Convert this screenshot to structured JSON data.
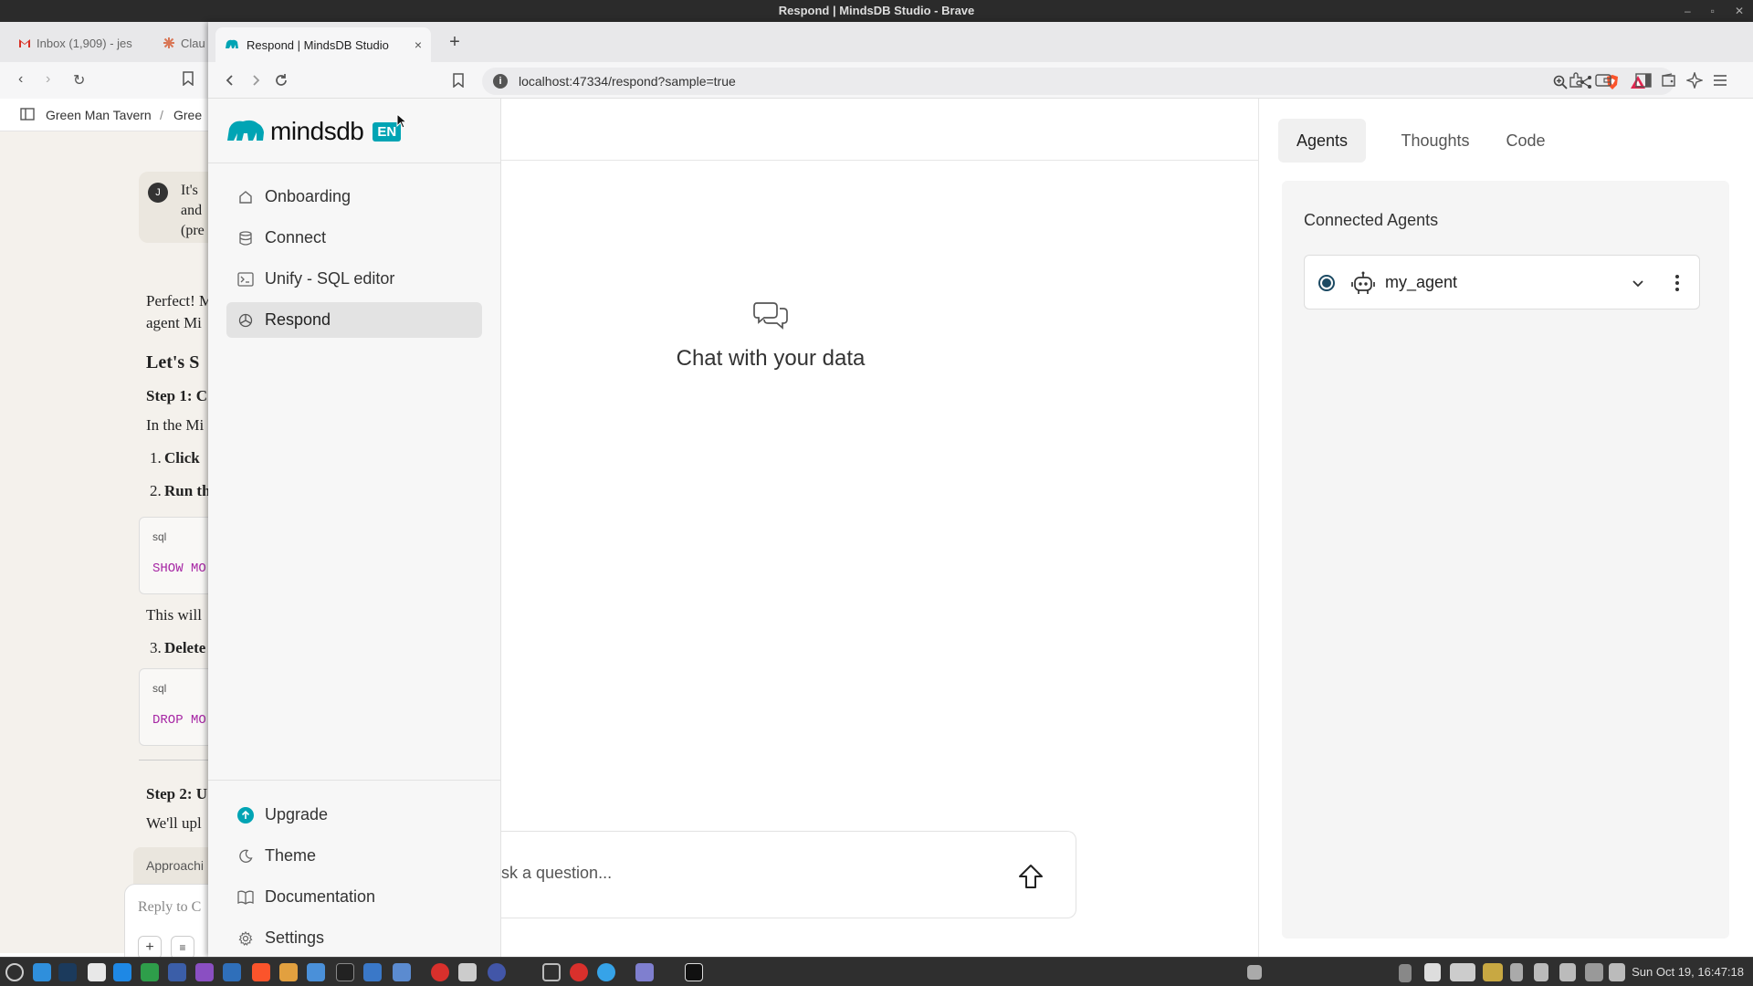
{
  "window_title": "Respond | MindsDB Studio - Brave",
  "background_window": {
    "tabs": [
      "Inbox (1,909) - jes",
      "Clau"
    ],
    "breadcrumb": [
      "Green Man Tavern",
      "/",
      "Gree"
    ],
    "chat_fragments": {
      "avatar_initial": "J",
      "msg_lines": [
        "It's",
        "and",
        "(pre"
      ],
      "p1": "Perfect! M",
      "p2": "agent Mi",
      "h1": "Let's S",
      "step1": "Step 1: C",
      "in_the": "In the Mi",
      "li1_num": "1.",
      "li1": "Click",
      "li2_num": "2.",
      "li2": "Run th",
      "code1_lang": "sql",
      "code1": "SHOW MO",
      "this_will": "This will",
      "li3_num": "3.",
      "li3": "Delete",
      "code2_lang": "sql",
      "code2": "DROP MO",
      "step2": "Step 2: U",
      "well": "We'll upl",
      "approach": "Approachi",
      "reply": "Reply to C"
    }
  },
  "tab": {
    "title": "Respond | MindsDB Studio",
    "close": "×",
    "new_tab": "+"
  },
  "url": "localhost:47334/respond?sample=true",
  "app": {
    "logo_text": "mindsdb",
    "lang_badge": "EN",
    "nav": {
      "onboarding": "Onboarding",
      "connect": "Connect",
      "unify": "Unify - SQL editor",
      "respond": "Respond"
    },
    "bottom_nav": {
      "upgrade": "Upgrade",
      "theme": "Theme",
      "documentation": "Documentation",
      "settings": "Settings"
    },
    "chat": {
      "empty_title": "Chat with your data",
      "placeholder": "sk a question..."
    },
    "right_panel": {
      "tabs": {
        "agents": "Agents",
        "thoughts": "Thoughts",
        "code": "Code"
      },
      "active_tab": "Agents",
      "section_title": "Connected Agents",
      "agent_name": "my_agent"
    }
  },
  "taskbar": {
    "clock": "Sun Oct 19, 16:47:18"
  },
  "colors": {
    "brand": "#00a4b4",
    "radio": "#1c4a63",
    "sidebar_active": "#e3e3e3"
  },
  "icons": [
    "home-icon",
    "database-icon",
    "terminal-icon",
    "agent-icon",
    "upgrade-icon",
    "moon-icon",
    "book-icon",
    "gear-icon",
    "chat-bubbles-icon",
    "send-arrow-icon",
    "robot-icon",
    "chevron-down-icon",
    "kebab-icon"
  ]
}
